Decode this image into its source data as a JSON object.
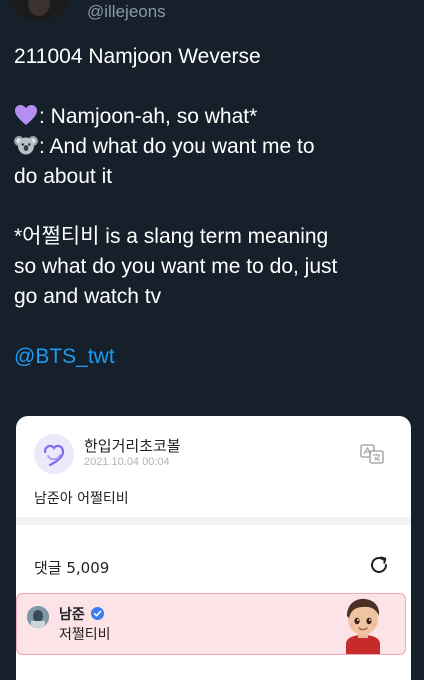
{
  "tweet": {
    "handle": "@illejeons",
    "lines": {
      "title": "211004 Namjoon Weverse",
      "heart_line": ": Namjoon-ah, so what*",
      "koala_line_1": ": And what do you want me to",
      "koala_line_2": "do about it",
      "note_line_1": "*어쩔티비 is a slang term meaning",
      "note_line_2": "so what do you want me to do, just",
      "note_line_3": "go and watch tv"
    },
    "mention": "@BTS_twt",
    "icons": {
      "heart": "purple-heart-icon",
      "koala": "koala-icon"
    }
  },
  "weverse_card": {
    "author": "한입거리초코볼",
    "date": "2021.10.04 00:04",
    "body": "남준아 어쩔티비",
    "comments_label": "댓글 5,009",
    "comment": {
      "author": "남준",
      "text": "저쩔티비"
    },
    "icons": {
      "translate": "translate-icon",
      "refresh": "refresh-icon",
      "verified": "verified-badge-icon"
    }
  },
  "colors": {
    "background": "#15202b",
    "text": "#ffffff",
    "secondary_text": "#8b98a5",
    "link": "#1d9bf0",
    "comment_highlight": "#fbe3e7",
    "comment_border": "#f2a7b4"
  }
}
